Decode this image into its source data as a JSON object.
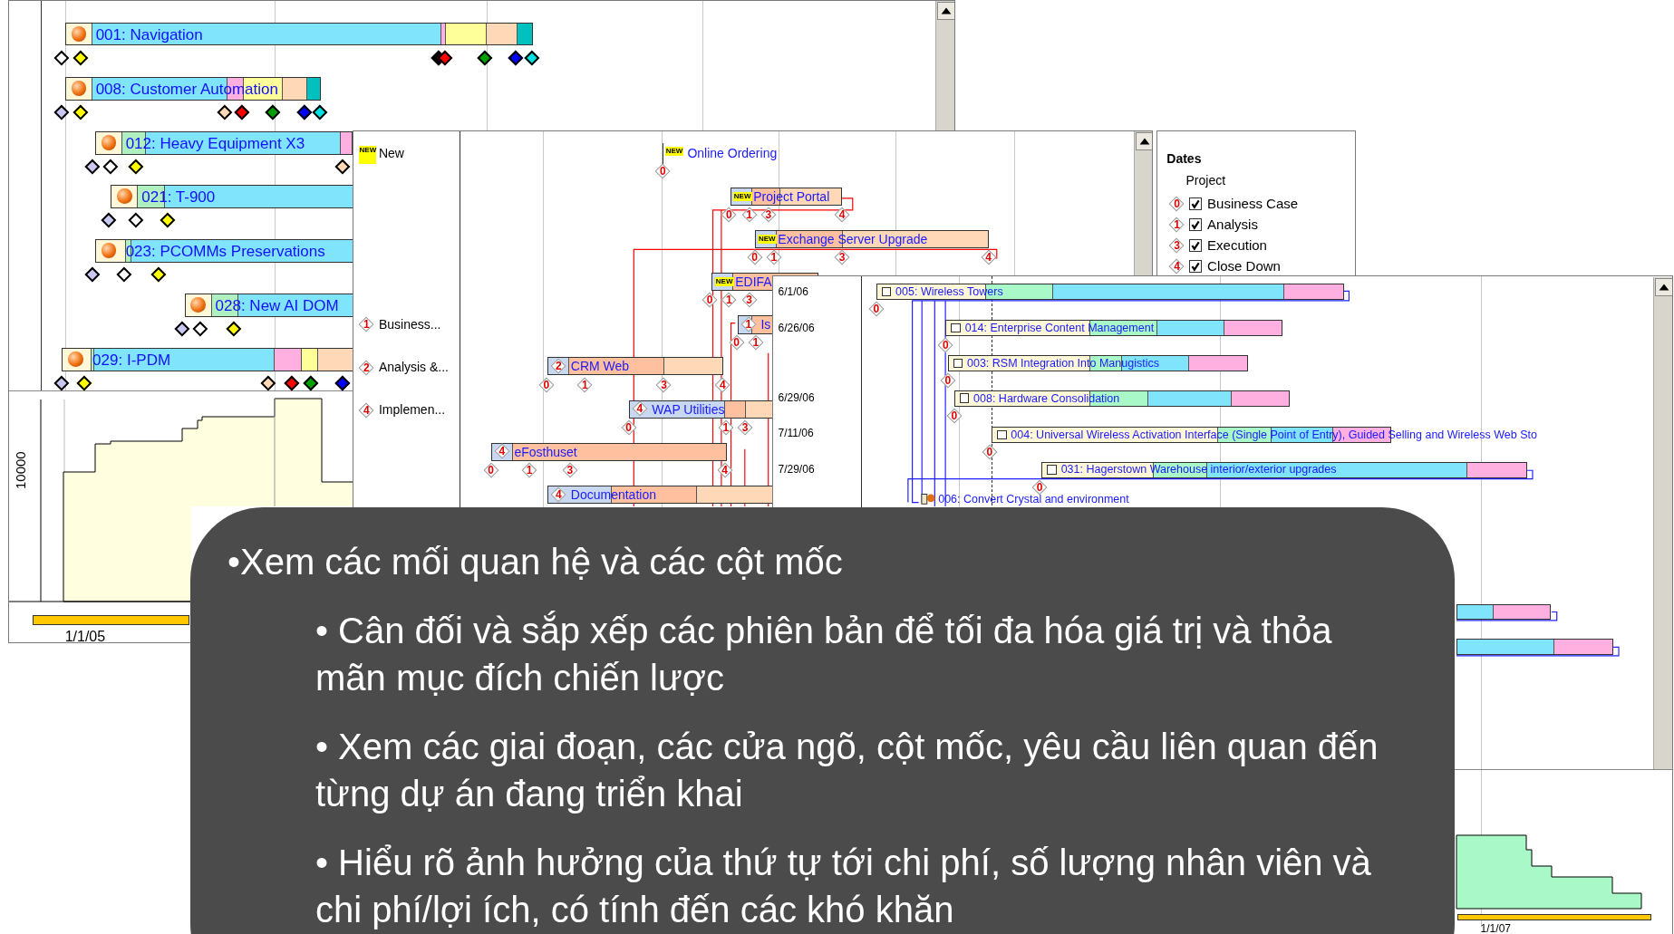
{
  "portfolio": {
    "rows": [
      {
        "name": "001: Navigation",
        "milestones": [
          {
            "color": "#ffffff"
          },
          {
            "color": "#ffff00"
          },
          {
            "color": "#000000"
          },
          {
            "color": "#ff0000"
          },
          {
            "color": "#00a000"
          },
          {
            "color": "#0000ff"
          },
          {
            "color": "#00e0e0"
          }
        ]
      },
      {
        "name": "008: Customer Automation",
        "milestones": [
          {
            "color": "#c8c8f0"
          },
          {
            "color": "#ffff00"
          },
          {
            "color": "#ffd8b8"
          },
          {
            "color": "#ff0000"
          },
          {
            "color": "#00a000"
          },
          {
            "color": "#0000ff"
          },
          {
            "color": "#00e0e0"
          }
        ]
      },
      {
        "name": "012: Heavy Equipment X3",
        "milestones": [
          {
            "color": "#c8c8f0"
          },
          {
            "color": "#ffffff"
          },
          {
            "color": "#ffff00"
          },
          {
            "color": "#ffd8b8"
          }
        ]
      },
      {
        "name": "021: T-900",
        "milestones": [
          {
            "color": "#c8c8f0"
          },
          {
            "color": "#ffffff"
          },
          {
            "color": "#ffff00"
          }
        ]
      },
      {
        "name": "023: PCOMMs Preservations",
        "milestones": [
          {
            "color": "#c8c8f0"
          },
          {
            "color": "#ffffff"
          },
          {
            "color": "#ffff00"
          }
        ]
      },
      {
        "name": "028: New AI DOM",
        "milestones": [
          {
            "color": "#c8c8f0"
          },
          {
            "color": "#ffffff"
          },
          {
            "color": "#ffff00"
          }
        ]
      },
      {
        "name": "029: I-PDM",
        "milestones": [
          {
            "color": "#c8c8f0"
          },
          {
            "color": "#ffff00"
          },
          {
            "color": "#ffd8b8"
          },
          {
            "color": "#ff0000"
          },
          {
            "color": "#00a000"
          },
          {
            "color": "#0000ff"
          }
        ]
      }
    ],
    "chart": {
      "y_label": "10000",
      "x_labels": [
        "1/1/05"
      ]
    }
  },
  "stage_gates": {
    "stages": [
      {
        "text": "New",
        "marker": {
          "kind": "new",
          "text": "NEW"
        }
      },
      {
        "text": "Business...",
        "marker": {
          "kind": "stage",
          "text": "1"
        }
      },
      {
        "text": "Analysis &...",
        "marker": {
          "kind": "stage",
          "text": "2"
        }
      },
      {
        "text": "Implemen...",
        "marker": {
          "kind": "stage",
          "text": "4"
        }
      }
    ],
    "projects": [
      {
        "kind": "marker",
        "name": "Online Ordering",
        "badge": {
          "kind": "new",
          "text": "NEW"
        },
        "gates": [
          "0"
        ]
      },
      {
        "kind": "bar",
        "name": "Project Portal",
        "badge": {
          "kind": "new",
          "text": "NEW"
        },
        "gates": [
          "0",
          "1",
          "3",
          "4"
        ]
      },
      {
        "kind": "bar",
        "name": "Exchange Server Upgrade",
        "badge": {
          "kind": "new",
          "text": "NEW"
        },
        "gates": [
          "0",
          "1",
          "3",
          "4"
        ]
      },
      {
        "kind": "bar",
        "name": "EDIFA",
        "badge": {
          "kind": "new",
          "text": "NEW"
        },
        "gates": [
          "0",
          "1",
          "3"
        ]
      },
      {
        "kind": "bar",
        "name": "Is",
        "badge": {
          "kind": "stage",
          "text": "1"
        },
        "gates": [
          "0",
          "1"
        ]
      },
      {
        "kind": "bar",
        "name": "CRM Web",
        "badge": {
          "kind": "stage",
          "text": "2"
        },
        "gates": [
          "0",
          "1",
          "3",
          "4"
        ]
      },
      {
        "kind": "bar",
        "name": "WAP Utilities",
        "badge": {
          "kind": "stage",
          "text": "4"
        },
        "gates": [
          "0",
          "1",
          "3"
        ]
      },
      {
        "kind": "bar",
        "name": "eFosthuset",
        "badge": {
          "kind": "stage",
          "text": "4"
        },
        "gates": [
          "0",
          "1",
          "3",
          "4"
        ]
      },
      {
        "kind": "bar",
        "name": "Documentation",
        "badge": {
          "kind": "stage",
          "text": "4"
        }
      }
    ]
  },
  "legend": {
    "title": "Dates",
    "subtitle": "Project",
    "items": [
      {
        "marker": "0",
        "label": "Business Case",
        "checked": true
      },
      {
        "marker": "1",
        "label": "Analysis",
        "checked": true
      },
      {
        "marker": "3",
        "label": "Execution",
        "checked": true
      },
      {
        "marker": "4",
        "label": "Close Down",
        "checked": true
      }
    ]
  },
  "schedule": {
    "dates": [
      "6/1/06",
      "6/26/06",
      "6/29/06",
      "7/11/06",
      "7/29/06"
    ],
    "tasks": [
      {
        "kind": "bar",
        "name": "005: Wireless Towers",
        "gate": "0"
      },
      {
        "kind": "bar",
        "name": "014: Enterprise Content Management",
        "gate": "0"
      },
      {
        "kind": "bar",
        "name": "003: RSM Integration Into Manugistics",
        "gate": "0"
      },
      {
        "kind": "bar",
        "name": "008: Hardware Consolidation",
        "gate": "0"
      },
      {
        "kind": "bar",
        "name": "004: Universal Wireless Activation Interface (Single Point of Entry), Guided Selling and Wireless Web Sto",
        "gate": "0"
      },
      {
        "kind": "bar",
        "name": "031: Hagerstown Warehouse interior/exterior upgrades",
        "gate": "0"
      },
      {
        "kind": "milestone",
        "name": "006: Convert Crystal and environment"
      },
      {
        "kind": "bar"
      },
      {
        "kind": "bar"
      }
    ],
    "chart": {
      "x_labels": [
        "1/1/07"
      ]
    }
  },
  "caption": {
    "bullets": [
      "•Xem các mối quan hệ và các cột mốc",
      "• Cân đối và sắp xếp các phiên bản để tối đa hóa giá trị và thỏa mãn mục đích chiến lược",
      "• Xem các giai đoạn, các cửa ngõ, cột mốc, yêu cầu liên quan đến từng dự án đang triển khai",
      "• Hiểu rõ ảnh hưởng của thứ tự tới chi phí, số lượng nhân viên và chi phí/lợi ích, có tính đến các khó khăn"
    ]
  }
}
